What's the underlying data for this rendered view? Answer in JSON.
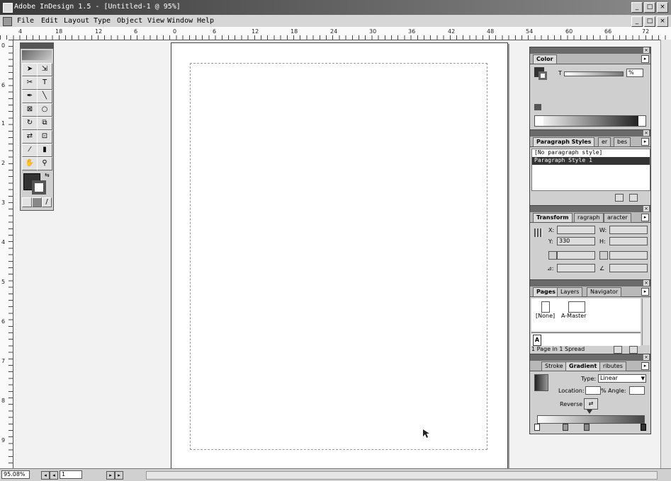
{
  "window": {
    "title": "Adobe InDesign 1.5 - [Untitled-1 @ 95%]",
    "minimize": "_",
    "maximize": "□",
    "close": "×"
  },
  "menu": [
    "File",
    "Edit",
    "Layout",
    "Type",
    "Object",
    "View",
    "Window",
    "Help"
  ],
  "ruler": {
    "h_labels": [
      "4",
      "18",
      "12",
      "6",
      "0",
      "6",
      "12",
      "18",
      "24",
      "30",
      "36",
      "42",
      "48",
      "54",
      "60",
      "66",
      "72"
    ],
    "v_labels": [
      "0",
      "6",
      "1",
      "2",
      "3",
      "4",
      "5",
      "6",
      "7",
      "8",
      "9"
    ]
  },
  "panels": {
    "color": {
      "tab": "Color",
      "tint_label": "T",
      "tint_value": "%"
    },
    "paragraph_styles": {
      "tab": "Paragraph Styles",
      "tab2": "er",
      "tab3": "bes",
      "items": [
        "[No paragraph style]",
        "Paragraph Style 1"
      ]
    },
    "transform": {
      "tab": "Transform",
      "tab2": "ragraph",
      "tab3": "aracter",
      "x_label": "X:",
      "y_label": "Y:",
      "w_label": "W:",
      "h_label": "H:",
      "y_value": "330",
      "angle_label": "⊿:"
    },
    "pages": {
      "tab": "Pages",
      "tab2": "Layers",
      "tab3": "Navigator",
      "none_label": "[None]",
      "master_label": "A-Master",
      "page_label": "A",
      "footer": "1 Page in 1 Spread"
    },
    "gradient": {
      "tab1": "Stroke",
      "tab": "Gradient",
      "tab3": "ributes",
      "type_label": "Type:",
      "type_value": "Linear",
      "location_label": "Location:",
      "angle_label": "% Angle:",
      "reverse_label": "Reverse"
    }
  },
  "status": {
    "zoom": "95.08%",
    "page": "1"
  },
  "colors": {
    "titlebar": "#4a4a4a",
    "selection": "#333333",
    "panel_bg": "#cfcfcf"
  }
}
